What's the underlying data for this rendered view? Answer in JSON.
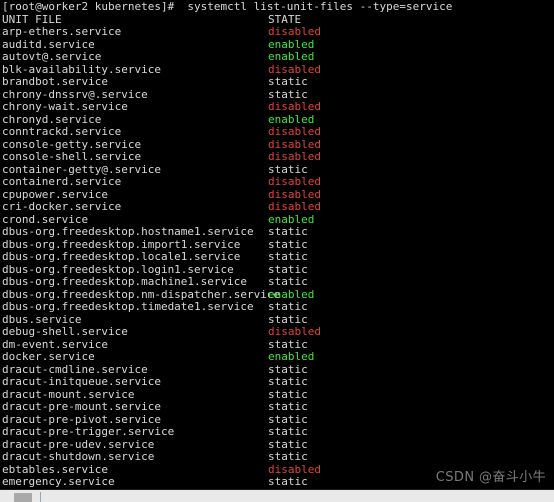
{
  "terminal": {
    "prompt": "[root@worker2 kubernetes]#",
    "command": "systemctl list-unit-files --type=service",
    "prompt_line": "[root@worker2 kubernetes]#  systemctl list-unit-files --type=service",
    "columns": {
      "unit_file": "UNIT FILE",
      "state": "STATE"
    },
    "colors": {
      "background": "#000000",
      "foreground": "#d8d8d8",
      "enabled": "#3ee63e",
      "disabled": "#e04141",
      "static": "#d8d8d8"
    },
    "rows": [
      {
        "unit": "arp-ethers.service",
        "state": "disabled"
      },
      {
        "unit": "auditd.service",
        "state": "enabled"
      },
      {
        "unit": "autovt@.service",
        "state": "enabled"
      },
      {
        "unit": "blk-availability.service",
        "state": "disabled"
      },
      {
        "unit": "brandbot.service",
        "state": "static"
      },
      {
        "unit": "chrony-dnssrv@.service",
        "state": "static"
      },
      {
        "unit": "chrony-wait.service",
        "state": "disabled"
      },
      {
        "unit": "chronyd.service",
        "state": "enabled"
      },
      {
        "unit": "conntrackd.service",
        "state": "disabled"
      },
      {
        "unit": "console-getty.service",
        "state": "disabled"
      },
      {
        "unit": "console-shell.service",
        "state": "disabled"
      },
      {
        "unit": "container-getty@.service",
        "state": "static"
      },
      {
        "unit": "containerd.service",
        "state": "disabled"
      },
      {
        "unit": "cpupower.service",
        "state": "disabled"
      },
      {
        "unit": "cri-docker.service",
        "state": "disabled"
      },
      {
        "unit": "crond.service",
        "state": "enabled"
      },
      {
        "unit": "dbus-org.freedesktop.hostname1.service",
        "state": "static"
      },
      {
        "unit": "dbus-org.freedesktop.import1.service",
        "state": "static"
      },
      {
        "unit": "dbus-org.freedesktop.locale1.service",
        "state": "static"
      },
      {
        "unit": "dbus-org.freedesktop.login1.service",
        "state": "static"
      },
      {
        "unit": "dbus-org.freedesktop.machine1.service",
        "state": "static"
      },
      {
        "unit": "dbus-org.freedesktop.nm-dispatcher.service",
        "state": "enabled"
      },
      {
        "unit": "dbus-org.freedesktop.timedate1.service",
        "state": "static"
      },
      {
        "unit": "dbus.service",
        "state": "static"
      },
      {
        "unit": "debug-shell.service",
        "state": "disabled"
      },
      {
        "unit": "dm-event.service",
        "state": "static"
      },
      {
        "unit": "docker.service",
        "state": "enabled"
      },
      {
        "unit": "dracut-cmdline.service",
        "state": "static"
      },
      {
        "unit": "dracut-initqueue.service",
        "state": "static"
      },
      {
        "unit": "dracut-mount.service",
        "state": "static"
      },
      {
        "unit": "dracut-pre-mount.service",
        "state": "static"
      },
      {
        "unit": "dracut-pre-pivot.service",
        "state": "static"
      },
      {
        "unit": "dracut-pre-trigger.service",
        "state": "static"
      },
      {
        "unit": "dracut-pre-udev.service",
        "state": "static"
      },
      {
        "unit": "dracut-shutdown.service",
        "state": "static"
      },
      {
        "unit": "ebtables.service",
        "state": "disabled"
      },
      {
        "unit": "emergency.service",
        "state": "static"
      }
    ]
  },
  "watermark": {
    "text": "CSDN @奋斗小牛"
  }
}
